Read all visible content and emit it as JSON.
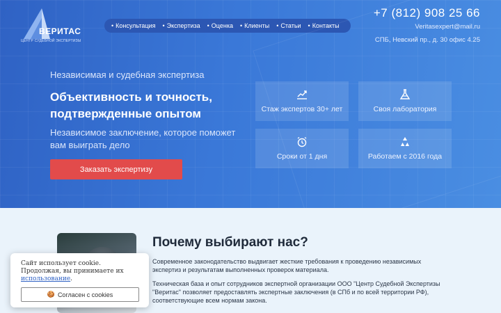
{
  "brand": {
    "name": "ВЕРИТАС",
    "subtitle": "ЦЕНТР СУДЕБНОЙ ЭКСПЕРТИЗЫ"
  },
  "nav": {
    "items": [
      "Консультация",
      "Экспертиза",
      "Оценка",
      "Клиенты",
      "Статьи",
      "Контакты"
    ]
  },
  "contacts": {
    "phone": "+7 (812) 908 25 66",
    "email": "Veritasexpert@mail.ru",
    "address": "СПБ, Невский пр., д. 30 офис 4.25"
  },
  "hero": {
    "kicker": "Независимая и судебная экспертиза",
    "title": "Объективность и точность, подтвержденные опытом",
    "description": "Независимое заключение, которое поможет вам выиграть дело",
    "cta": "Заказать экспертизу"
  },
  "features": [
    {
      "label": "Стаж экспертов 30+ лет",
      "icon": "chart-icon"
    },
    {
      "label": "Своя лаборатория",
      "icon": "flask-icon"
    },
    {
      "label": "Сроки от 1 дня",
      "icon": "alarm-clock-icon"
    },
    {
      "label": "Работаем с 2016 года",
      "icon": "recycle-icon"
    }
  ],
  "why": {
    "title": "Почему выбирают нас?",
    "p1": "Современное законодательство выдвигает жесткие требования к проведению независимых экспертиз и результатам выполненных проверок материала.",
    "p2": "Техническая база и опыт сотрудников экспертной организации ООО \"Центр Судебной Экспертизы \"Веритас\" позволяет предоставлять экспертные заключения (в СПб и по всей территории РФ), соответствующие всем нормам закона."
  },
  "cookie": {
    "text": "Сайт использует cookie. Продолжая, вы принимаете их",
    "link": "использование",
    "button": "Согласен с cookies"
  },
  "colors": {
    "accent": "#e24b4b",
    "hero": "#3a78d8",
    "nav": "#2c57b3"
  }
}
